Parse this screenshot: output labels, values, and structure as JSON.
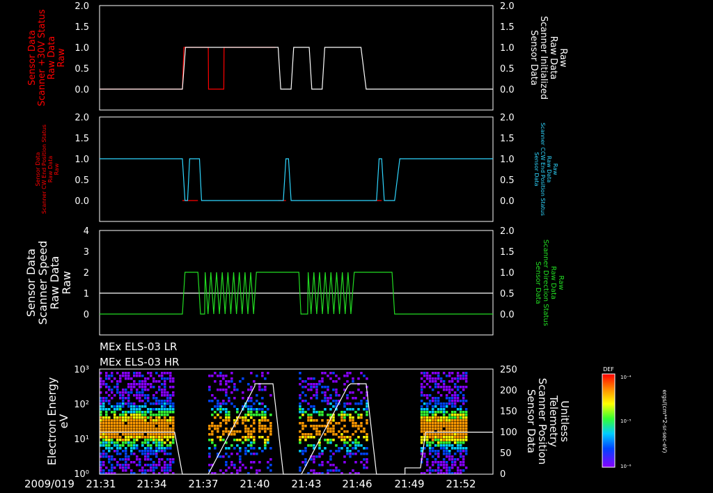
{
  "date_label": "2009/019",
  "time_ticks": [
    "21:31",
    "21:34",
    "21:37",
    "21:40",
    "21:43",
    "21:46",
    "21:49",
    "21:52"
  ],
  "inst_labels": [
    "MEx ELS-03 LR",
    "MEx ELS-03 HR"
  ],
  "colors": {
    "red": "#ff0000",
    "white": "#ffffff",
    "cyan": "#2fd6ff",
    "green": "#22dd22"
  },
  "chart_data": [
    {
      "type": "line",
      "left_ylabel": [
        "Sensor Data",
        "Scanner +30V Status",
        "Raw Data",
        "Raw"
      ],
      "right_ylabel": [
        "Sensor Data",
        "Scanner Initialized",
        "Raw Data",
        "Raw"
      ],
      "left_ticks": [
        "2.0",
        "1.5",
        "1.0",
        "0.5",
        "0.0"
      ],
      "right_ticks": [
        "2.0",
        "1.5",
        "1.0",
        "0.5",
        "0.0"
      ],
      "ylim": [
        -0.5,
        2.0
      ],
      "series": [
        {
          "color": "red",
          "values": [
            [
              0,
              0
            ],
            [
              16.0,
              0
            ],
            [
              16.3,
              1
            ],
            [
              21,
              1
            ],
            [
              21.05,
              0
            ],
            [
              24,
              0
            ],
            [
              24.05,
              1
            ],
            [
              34,
              1
            ]
          ]
        },
        {
          "color": "white",
          "values": [
            [
              0,
              0
            ],
            [
              16.0,
              0
            ],
            [
              16.6,
              1
            ],
            [
              34.5,
              1
            ],
            [
              35,
              0
            ],
            [
              37,
              0
            ],
            [
              37.5,
              1
            ],
            [
              40.5,
              1
            ],
            [
              41,
              0
            ],
            [
              43,
              0
            ],
            [
              43.5,
              1
            ],
            [
              50.5,
              1
            ],
            [
              51.5,
              0
            ],
            [
              76,
              0
            ]
          ]
        }
      ]
    },
    {
      "type": "line",
      "left_ylabel": [
        "Sensor Data",
        "Scanner CW End Position Status",
        "Raw Data",
        "Raw"
      ],
      "right_ylabel": [
        "Sensor Data",
        "Scanner CCW End Position Status",
        "Raw Data",
        "Raw"
      ],
      "left_ticks": [
        "2.0",
        "1.5",
        "1.0",
        "0.5",
        "0.0"
      ],
      "right_ticks": [
        "2.0",
        "1.5",
        "1.0",
        "0.5",
        "0.0"
      ],
      "ylim": [
        -0.5,
        2.0
      ],
      "series": [
        {
          "color": "red",
          "values": [
            [
              16,
              0
            ],
            [
              19,
              0
            ],
            [
              34.5,
              0
            ],
            [
              36,
              0
            ],
            [
              53,
              0
            ],
            [
              54.5,
              0
            ]
          ]
        },
        {
          "color": "cyan",
          "values": [
            [
              0,
              1
            ],
            [
              16,
              1
            ],
            [
              16.5,
              0
            ],
            [
              17,
              0
            ],
            [
              17.4,
              1
            ],
            [
              19.3,
              1
            ],
            [
              19.7,
              0
            ],
            [
              35.5,
              0
            ],
            [
              36,
              1
            ],
            [
              36.5,
              1
            ],
            [
              37,
              0
            ],
            [
              53.5,
              0
            ],
            [
              54,
              1
            ],
            [
              54.5,
              1
            ],
            [
              55,
              0
            ],
            [
              57,
              0
            ],
            [
              58,
              1
            ],
            [
              76,
              1
            ]
          ]
        }
      ]
    },
    {
      "type": "line",
      "left_ylabel": [
        "Sensor Data",
        "Scanner Speed",
        "Raw Data",
        "Raw"
      ],
      "right_ylabel": [
        "Sensor Data",
        "Scanner Direction Status",
        "Raw Data",
        "Raw"
      ],
      "left_ticks": [
        "4",
        "3",
        "2",
        "1",
        "0"
      ],
      "right_ticks": [
        "2.0",
        "1.5",
        "1.0",
        "0.5",
        "0.0"
      ],
      "ylim": [
        -1,
        4
      ],
      "reference_line": 1,
      "series": [
        {
          "color": "green",
          "pattern": "square wave 0↔2, oscillating 21:37–21:39 and 21:43–21:45",
          "values": [
            [
              0,
              0
            ],
            [
              16,
              0
            ],
            [
              16.5,
              2
            ],
            [
              19,
              2
            ],
            [
              19.5,
              0
            ],
            [
              20.5,
              0
            ],
            [
              21,
              2
            ]
          ]
        }
      ]
    },
    {
      "type": "heatmap",
      "left_ylabel": [
        "Electron Energy",
        "eV"
      ],
      "right_ylabel": [
        "Sensor Data",
        "Scanner Position",
        "Telemetry",
        "Unitless"
      ],
      "left_ticks": [
        "10³",
        "10²",
        "10¹",
        "10⁰"
      ],
      "right_ticks": [
        "250",
        "200",
        "150",
        "100",
        "50",
        "0"
      ],
      "yscale": "log",
      "ylim": [
        1,
        1000
      ],
      "colorbar": {
        "label": "DEF",
        "unit": "ergs/(cm**2-sr-sec-eV)",
        "ticks": [
          "10⁻⁴",
          "10⁻⁵",
          "10⁻⁶"
        ]
      },
      "data_blocks_time": [
        [
          "21:31",
          "21:35"
        ],
        [
          "21:37",
          "21:40"
        ],
        [
          "21:43",
          "21:46"
        ],
        [
          "21:50",
          "21:52"
        ]
      ],
      "line_values": [
        [
          0,
          100
        ],
        [
          2,
          100
        ],
        [
          21,
          100
        ],
        [
          23,
          140
        ],
        [
          27,
          210
        ],
        [
          30,
          210
        ],
        [
          33,
          0
        ],
        [
          60,
          0
        ],
        [
          62,
          60
        ],
        [
          63,
          100
        ],
        [
          76,
          100
        ]
      ]
    }
  ]
}
